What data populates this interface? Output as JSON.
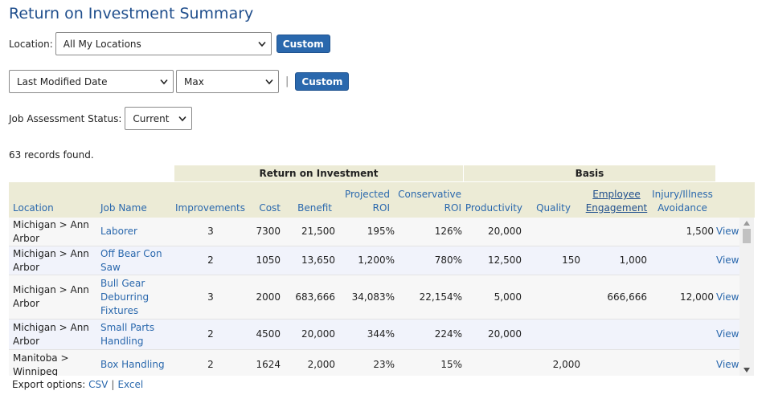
{
  "page": {
    "title": "Return on Investment Summary"
  },
  "filters": {
    "location_label": "Location:",
    "location_value": "All My Locations",
    "custom_label": "Custom",
    "date_field_value": "Last Modified Date",
    "date_range_value": "Max",
    "separator": "|",
    "custom2_label": "Custom",
    "status_label": "Job Assessment Status:",
    "status_value": "Current"
  },
  "records": "63 records found.",
  "table": {
    "groups": {
      "roi": "Return on Investment",
      "basis": "Basis"
    },
    "headers": {
      "location": "Location",
      "job_name": "Job Name",
      "improvements": "Improvements",
      "cost": "Cost",
      "benefit": "Benefit",
      "projected_1": "Projected",
      "projected_2": "ROI",
      "conservative_1": "Conservative",
      "conservative_2": "ROI",
      "productivity": "Productivity",
      "quality": "Quality",
      "engagement_1": "Employee",
      "engagement_2": "Engagement",
      "injury_1": "Injury/Illness",
      "injury_2": "Avoidance"
    },
    "rows": [
      {
        "location": "Michigan > Ann Arbor",
        "job": "Laborer",
        "improvements": "3",
        "cost": "7300",
        "benefit": "21,500",
        "projected": "195%",
        "conservative": "126%",
        "productivity": "20,000",
        "quality": "",
        "engagement": "",
        "injury": "1,500",
        "view": "View"
      },
      {
        "location": "Michigan > Ann Arbor",
        "job": "Off Bear Con Saw",
        "improvements": "2",
        "cost": "1050",
        "benefit": "13,650",
        "projected": "1,200%",
        "conservative": "780%",
        "productivity": "12,500",
        "quality": "150",
        "engagement": "1,000",
        "injury": "",
        "view": "View"
      },
      {
        "location": "Michigan > Ann Arbor",
        "job": "Bull Gear Deburring Fixtures",
        "improvements": "3",
        "cost": "2000",
        "benefit": "683,666",
        "projected": "34,083%",
        "conservative": "22,154%",
        "productivity": "5,000",
        "quality": "",
        "engagement": "666,666",
        "injury": "12,000",
        "view": "View"
      },
      {
        "location": "Michigan > Ann Arbor",
        "job": "Small Parts Handling",
        "improvements": "2",
        "cost": "4500",
        "benefit": "20,000",
        "projected": "344%",
        "conservative": "224%",
        "productivity": "20,000",
        "quality": "",
        "engagement": "",
        "injury": "",
        "view": "View"
      },
      {
        "location": "Manitoba > Winnipeg",
        "job": "Box Handling",
        "improvements": "2",
        "cost": "1624",
        "benefit": "2,000",
        "projected": "23%",
        "conservative": "15%",
        "productivity": "",
        "quality": "2,000",
        "engagement": "",
        "injury": "",
        "view": "View"
      }
    ]
  },
  "export": {
    "label": "Export options:",
    "csv": "CSV",
    "separator": "|",
    "excel": "Excel"
  },
  "colors": {
    "accent": "#2a68ad",
    "header_bg": "#ecebd6",
    "alt_row": "#f1f3fb"
  },
  "icons": {
    "select": "chevron-down-icon",
    "scroll_up": "arrow-up-icon",
    "scroll_down": "arrow-down-icon"
  }
}
